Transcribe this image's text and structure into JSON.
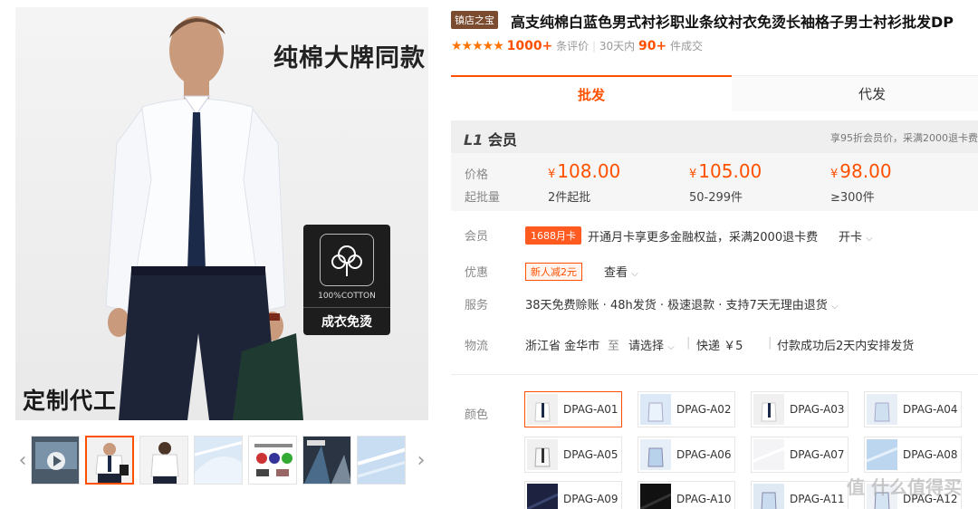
{
  "gallery": {
    "slogan": "纯棉大牌同款",
    "oem_text": "定制代工",
    "cotton_label": "100%COTTON",
    "cotton_tag": "成衣免烫",
    "thumb_count": 8
  },
  "product": {
    "shop_badge": "镇店之宝",
    "title": "高支纯棉白蓝色男式衬衫职业条纹衬衣免烫长袖格子男士衬衫批发DP",
    "stars": "★★★★★",
    "reviews_count": "1000+",
    "reviews_label": "条评价",
    "sold_prefix": "30天内",
    "sold_count": "90+",
    "sold_suffix": "件成交"
  },
  "tabs": {
    "wholesale": "批发",
    "dropship": "代发"
  },
  "member": {
    "level_icon": "L1",
    "level": "会员",
    "note": "享95折会员价，采满2000退卡费",
    "price_label": "价格",
    "qty_label": "起批量",
    "currency": "¥",
    "tiers": [
      {
        "price": "108.00",
        "qty": "2件起批"
      },
      {
        "price": "105.00",
        "qty": "50-299件"
      },
      {
        "price": "98.00",
        "qty": "≥300件"
      }
    ]
  },
  "rows": {
    "vip_label": "会员",
    "vip_tag": "1688月卡",
    "vip_text": "开通月卡享更多金融权益，采满2000退卡费",
    "vip_link": "开卡",
    "promo_label": "优惠",
    "promo_tag": "新人减2元",
    "promo_link": "查看",
    "service_label": "服务",
    "service_text": "38天免费赊账 · 48h发货 · 极速退款 · 支持7天无理由退货",
    "logistics_label": "物流",
    "from": "浙江省 金华市",
    "to_word": "至",
    "select": "请选择",
    "express": "快递 ￥5",
    "ship_note": "付款成功后2天内安排发货"
  },
  "colors": {
    "label": "颜色",
    "items": [
      "DPAG-A01",
      "DPAG-A02",
      "DPAG-A03",
      "DPAG-A04",
      "DPAG-A05",
      "DPAG-A06",
      "DPAG-A07",
      "DPAG-A08",
      "DPAG-A09",
      "DPAG-A10",
      "DPAG-A11",
      "DPAG-A12"
    ],
    "selected": "DPAG-A01"
  },
  "watermark": "值 什么值得买",
  "colors_theme": {
    "accent": "#ff5000",
    "badge": "#7a4b2e",
    "vip": "#ff5a1f"
  }
}
